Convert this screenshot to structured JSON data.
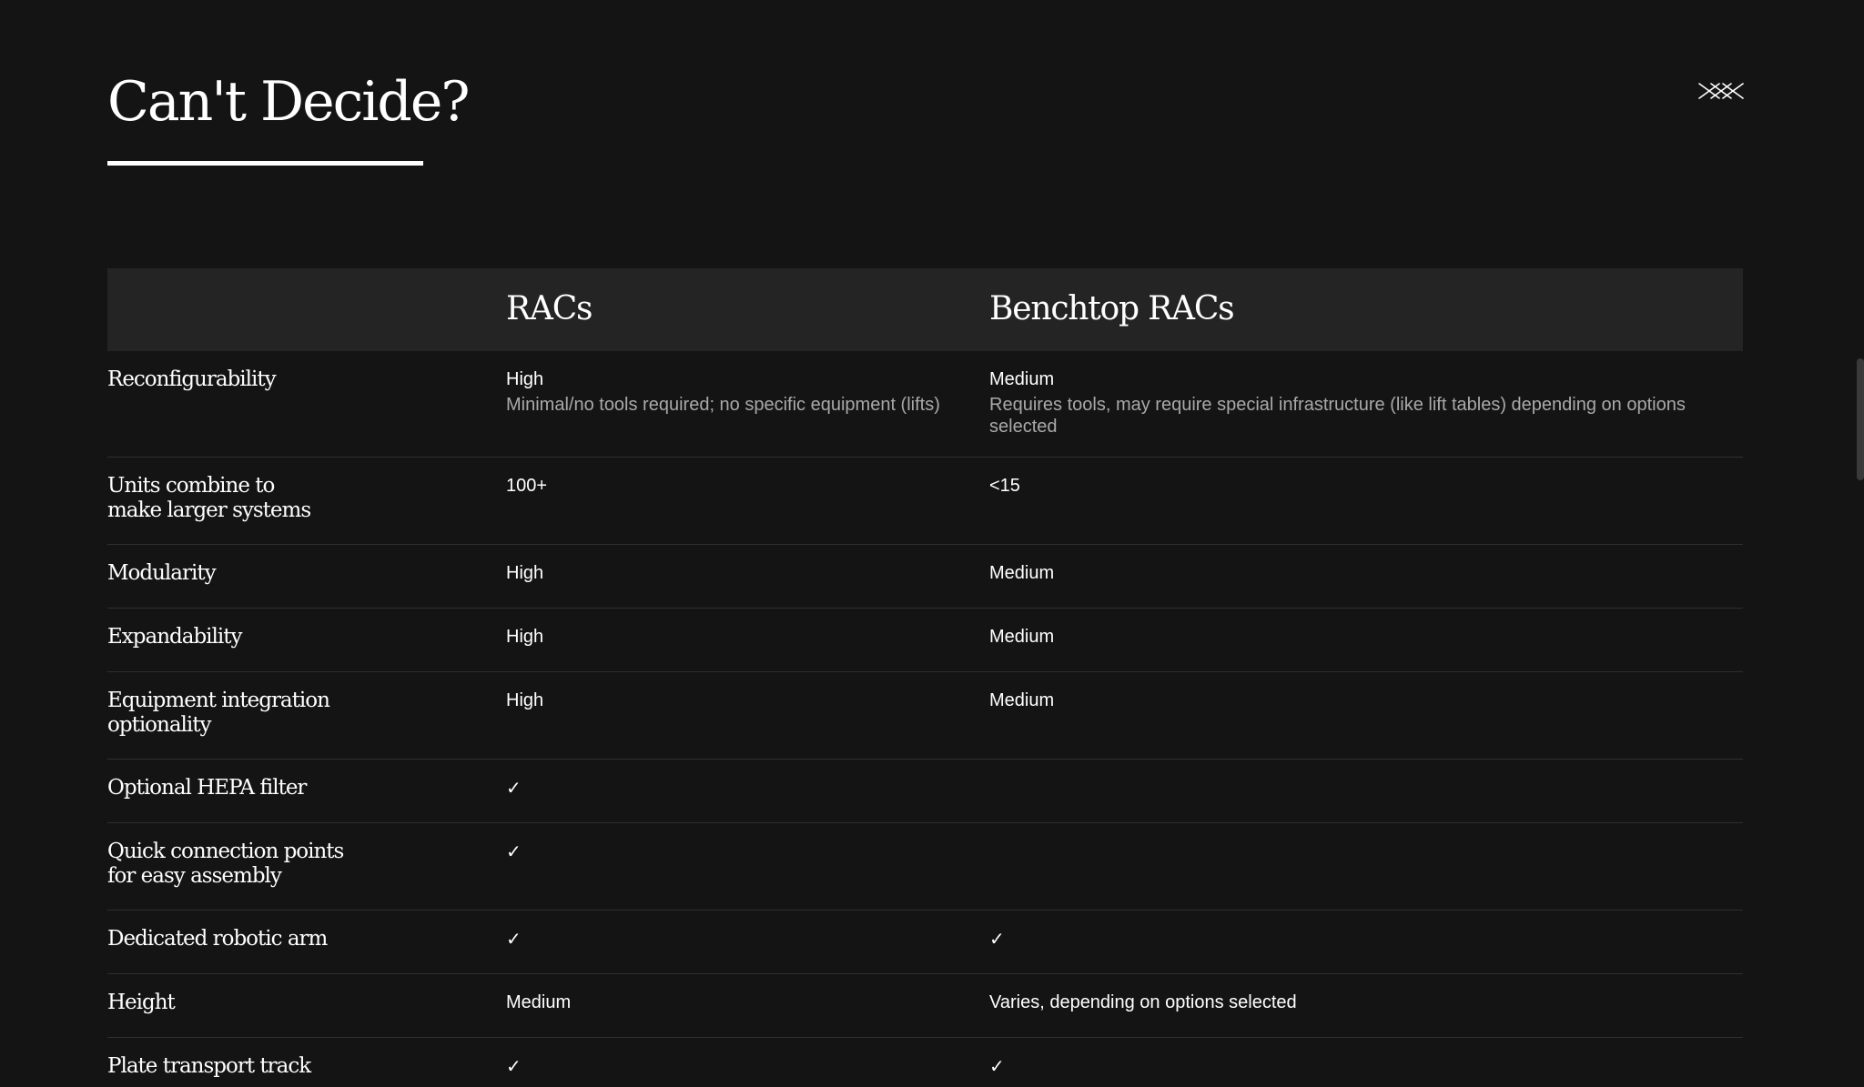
{
  "modal": {
    "title": "Can't Decide?",
    "close_icon": "close-icon"
  },
  "comparison": {
    "columns": [
      "",
      "RACs",
      "Benchtop RACs"
    ],
    "rows": [
      {
        "label": "Reconfigurability",
        "racs": "High",
        "racs_note": "Minimal/no tools required; no specific equipment (lifts)",
        "bench": "Medium",
        "bench_note": "Requires tools, may require special infrastructure (like lift tables) depending on options selected"
      },
      {
        "label": "Units combine to make larger systems",
        "racs": "100+",
        "bench": "<15"
      },
      {
        "label": "Modularity",
        "racs": "High",
        "bench": "Medium"
      },
      {
        "label": "Expandability",
        "racs": "High",
        "bench": "Medium"
      },
      {
        "label": "Equipment integration optionality",
        "racs": "High",
        "bench": "Medium"
      },
      {
        "label": "Optional HEPA filter",
        "racs": "✓",
        "bench": ""
      },
      {
        "label": "Quick connection points for easy assembly",
        "racs": "✓",
        "bench": ""
      },
      {
        "label": "Dedicated robotic arm",
        "racs": "✓",
        "bench": "✓"
      },
      {
        "label": "Height",
        "racs": "Medium",
        "bench": "Varies, depending on options selected"
      },
      {
        "label": "Plate transport track",
        "racs": "✓",
        "bench": "✓"
      }
    ]
  },
  "colors": {
    "background": "#141414",
    "header_row": "#242424",
    "divider": "#2f2f2f",
    "text": "#ffffff",
    "muted_text": "#a9a9a9"
  }
}
